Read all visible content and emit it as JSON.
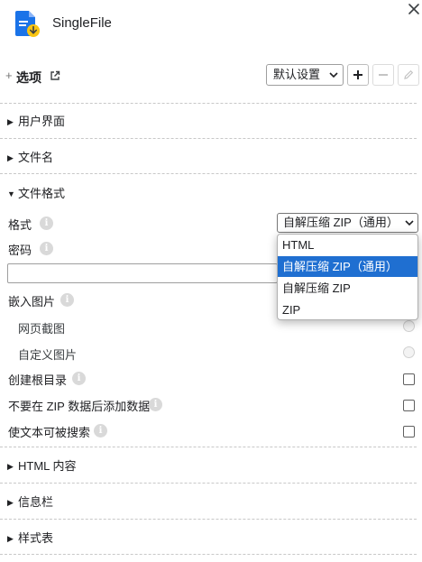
{
  "app": {
    "title": "SingleFile"
  },
  "options": {
    "plus": "+",
    "title": "选项",
    "profile": "默认设置"
  },
  "sections": [
    {
      "label": "用户界面",
      "expanded": false
    },
    {
      "label": "文件名",
      "expanded": false
    },
    {
      "label": "文件格式",
      "expanded": true
    },
    {
      "label": "HTML 内容",
      "expanded": false
    },
    {
      "label": "信息栏",
      "expanded": false
    },
    {
      "label": "样式表",
      "expanded": false
    }
  ],
  "file_format": {
    "format_label": "格式",
    "format_value": "自解压缩 ZIP（通用）",
    "password_label": "密码",
    "password_value": "",
    "embed_images_label": "嵌入图片",
    "embed_options": [
      {
        "label": "网页截图",
        "checked": false,
        "enabled": false
      },
      {
        "label": "自定义图片",
        "checked": false,
        "enabled": false
      }
    ],
    "create_root_dir_label": "创建根目录",
    "create_root_dir": false,
    "no_data_after_zip_label": "不要在 ZIP 数据后添加数据",
    "no_data_after_zip": false,
    "searchable_label": "使文本可被搜索",
    "searchable": false
  },
  "dropdown": {
    "options": [
      "HTML",
      "自解压缩 ZIP（通用）",
      "自解压缩 ZIP",
      "ZIP"
    ],
    "selected_index": 1
  },
  "info_glyph": "i",
  "triangle_collapsed": "▶",
  "triangle_expanded": "▼",
  "colors": {
    "accent": "#1f6fd1",
    "icon_blue": "#1a73e8",
    "icon_yellow": "#f9c513",
    "separator": "#c8c8c8"
  }
}
